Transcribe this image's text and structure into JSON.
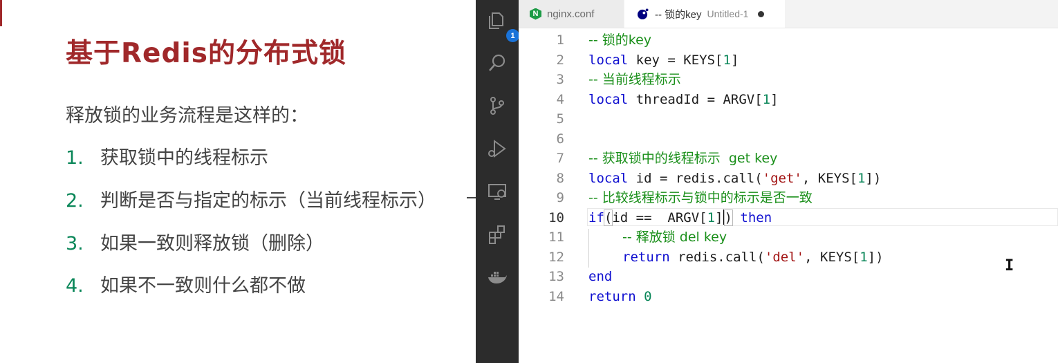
{
  "slide": {
    "title": "基于Redis的分布式锁",
    "intro": "释放锁的业务流程是这样的：",
    "steps": [
      {
        "num": "1.",
        "text": "获取锁中的线程标示"
      },
      {
        "num": "2.",
        "text": "判断是否与指定的标示（当前线程标示）"
      },
      {
        "num": "3.",
        "text": "如果一致则释放锁（删除）"
      },
      {
        "num": "4.",
        "text": "如果不一致则什么都不做"
      }
    ]
  },
  "activity_bar": {
    "explorer_badge": "1",
    "icons": [
      "files-icon",
      "search-icon",
      "source-control-icon",
      "run-debug-icon",
      "remote-explorer-icon",
      "extensions-icon",
      "docker-icon"
    ]
  },
  "tabs": [
    {
      "label": "nginx.conf",
      "icon": "nginx-icon",
      "icon_letter": "N",
      "active": false
    },
    {
      "label": "-- 锁的key",
      "description": "Untitled-1",
      "icon": "lua-icon",
      "active": true,
      "dirty": true
    }
  ],
  "editor": {
    "active_line": 10,
    "lines": [
      {
        "n": "1",
        "code": "-- 锁的key"
      },
      {
        "n": "2",
        "code": "local key = KEYS[1]"
      },
      {
        "n": "3",
        "code": "-- 当前线程标示"
      },
      {
        "n": "4",
        "code": "local threadId = ARGV[1]"
      },
      {
        "n": "5",
        "code": ""
      },
      {
        "n": "6",
        "code": ""
      },
      {
        "n": "7",
        "code": "-- 获取锁中的线程标示  get key"
      },
      {
        "n": "8",
        "code": "local id = redis.call('get', KEYS[1])"
      },
      {
        "n": "9",
        "code": "-- 比较线程标示与锁中的标示是否一致"
      },
      {
        "n": "10",
        "code": "if(id ==  ARGV[1]) then"
      },
      {
        "n": "11",
        "code": "    -- 释放锁 del key"
      },
      {
        "n": "12",
        "code": "    return redis.call('del', KEYS[1])"
      },
      {
        "n": "13",
        "code": "end"
      },
      {
        "n": "14",
        "code": "return 0"
      }
    ],
    "tokens": {
      "l1_cm": "-- 锁的key",
      "l2_kw": "local",
      "l2_rest": " key = KEYS[",
      "l2_num": "1",
      "l2_end": "]",
      "l3_cm": "-- 当前线程标示",
      "l4_kw": "local",
      "l4_rest": " threadId = ARGV[",
      "l4_num": "1",
      "l4_end": "]",
      "l7_cm": "-- 获取锁中的线程标示  get key",
      "l8_kw": "local",
      "l8_rest": " id = redis.call(",
      "l8_str": "'get'",
      "l8_mid": ", KEYS[",
      "l8_num": "1",
      "l8_end": "])",
      "l9_cm": "-- 比较线程标示与锁中的标示是否一致",
      "l10_kw": "if",
      "l10_open": "(",
      "l10_rest": "id ==  ARGV[",
      "l10_num": "1",
      "l10_end": "]",
      "l10_close": ")",
      "l10_kw2": " then",
      "l11_cm": "-- 释放锁 del key",
      "l12_kw": "return",
      "l12_rest": " redis.call(",
      "l12_str": "'del'",
      "l12_mid": ", KEYS[",
      "l12_num": "1",
      "l12_end": "])",
      "l13_kw": "end",
      "l14_kw": "return",
      "l14_num": "0"
    }
  },
  "colors": {
    "title": "#a0282a",
    "comment": "#1a8f1a",
    "keyword": "#1010d0",
    "string": "#a31515",
    "number": "#098658",
    "activity_bar": "#2c2c2c",
    "badge": "#1a73d9"
  }
}
